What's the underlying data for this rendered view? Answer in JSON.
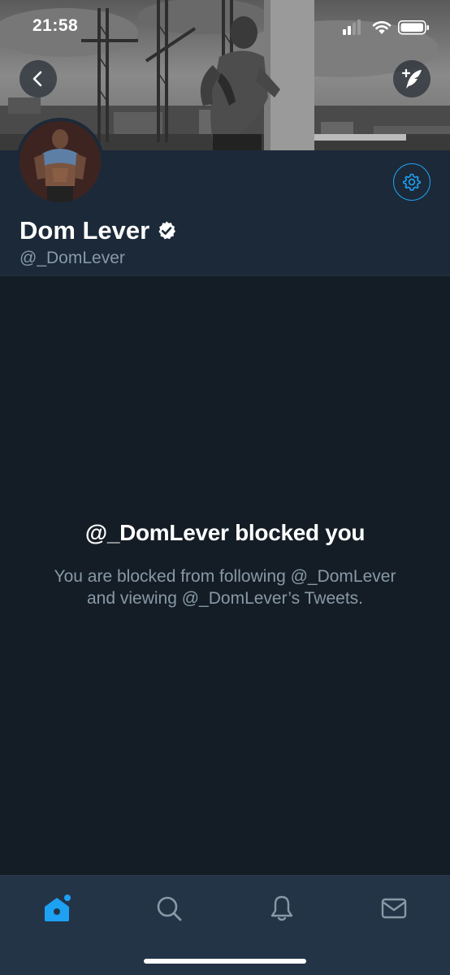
{
  "status_bar": {
    "time": "21:58",
    "icons": [
      "cellular-signal-icon",
      "wifi-icon",
      "battery-icon"
    ]
  },
  "header": {
    "back_icon": "chevron-left-icon",
    "compose_icon": "compose-tweet-icon",
    "settings_icon": "gear-icon"
  },
  "profile": {
    "display_name": "Dom Lever",
    "verified": true,
    "handle": "@_DomLever"
  },
  "blocked": {
    "title": "@_DomLever blocked you",
    "description": "You are blocked from following @_DomLever and viewing @_DomLever’s Tweets."
  },
  "tab_bar": {
    "tabs": [
      {
        "icon": "home-icon",
        "active": true,
        "has_new": true
      },
      {
        "icon": "search-icon",
        "active": false
      },
      {
        "icon": "bell-icon",
        "active": false
      },
      {
        "icon": "envelope-icon",
        "active": false
      }
    ]
  },
  "colors": {
    "background": "#141d26",
    "header_background": "#1c2938",
    "tab_bar_background": "#243447",
    "accent": "#1da1f2",
    "secondary_text": "#8899a6",
    "primary_text": "#ffffff"
  }
}
